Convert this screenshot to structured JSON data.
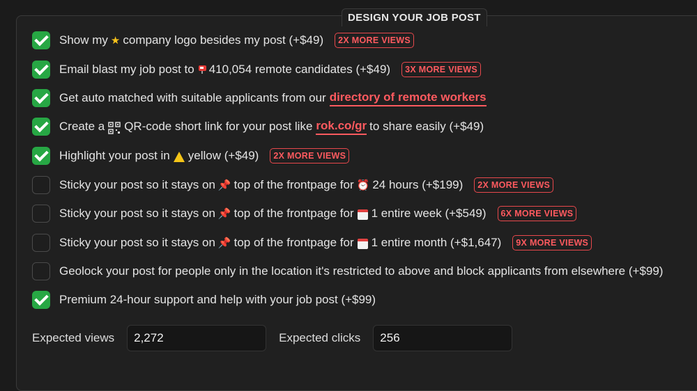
{
  "section": {
    "title": "DESIGN YOUR JOB POST"
  },
  "options": [
    {
      "checked": true,
      "before": "Show my",
      "icon": "star-icon",
      "after": "company logo besides my post (+$49)",
      "badge": "2X MORE VIEWS"
    },
    {
      "checked": true,
      "before": "Email blast my job post to",
      "icon": "mailbox-icon",
      "after": "410,054 remote candidates (+$49)",
      "badge": "3X MORE VIEWS"
    },
    {
      "checked": true,
      "before": "Get auto matched with suitable applicants from our",
      "link": "directory of remote workers"
    },
    {
      "checked": true,
      "before": "Create a",
      "icon": "qr-code-icon",
      "after": "QR-code short link for your post like",
      "link": "rok.co/gr",
      "after_link": "to share easily (+$49)"
    },
    {
      "checked": true,
      "before": "Highlight your post in",
      "icon": "warning-icon",
      "after": "yellow (+$49)",
      "badge": "2X MORE VIEWS"
    },
    {
      "checked": false,
      "before": "Sticky your post so it stays on",
      "icon": "pushpin-icon",
      "middle": "top of the frontpage for",
      "icon2": "alarm-clock-icon",
      "after": "24 hours (+$199)",
      "badge": "2X MORE VIEWS"
    },
    {
      "checked": false,
      "before": "Sticky your post so it stays on",
      "icon": "pushpin-icon",
      "middle": "top of the frontpage for",
      "icon2": "calendar-icon",
      "after": "1 entire week (+$549)",
      "badge": "6X MORE VIEWS"
    },
    {
      "checked": false,
      "before": "Sticky your post so it stays on",
      "icon": "pushpin-icon",
      "middle": "top of the frontpage for",
      "icon2": "calendar-icon",
      "after": "1 entire month (+$1,647)",
      "badge": "9X MORE VIEWS"
    },
    {
      "checked": false,
      "before": "Geolock your post for people only in the location it's restricted to above and block applicants from elsewhere (+$99)"
    },
    {
      "checked": true,
      "before": "Premium 24-hour support and help with your job post (+$99)"
    }
  ],
  "stats": {
    "views_label": "Expected views",
    "views_value": "2,272",
    "clicks_label": "Expected clicks",
    "clicks_value": "256"
  },
  "colors": {
    "accent": "#ff5a5f",
    "check": "#27a744"
  }
}
